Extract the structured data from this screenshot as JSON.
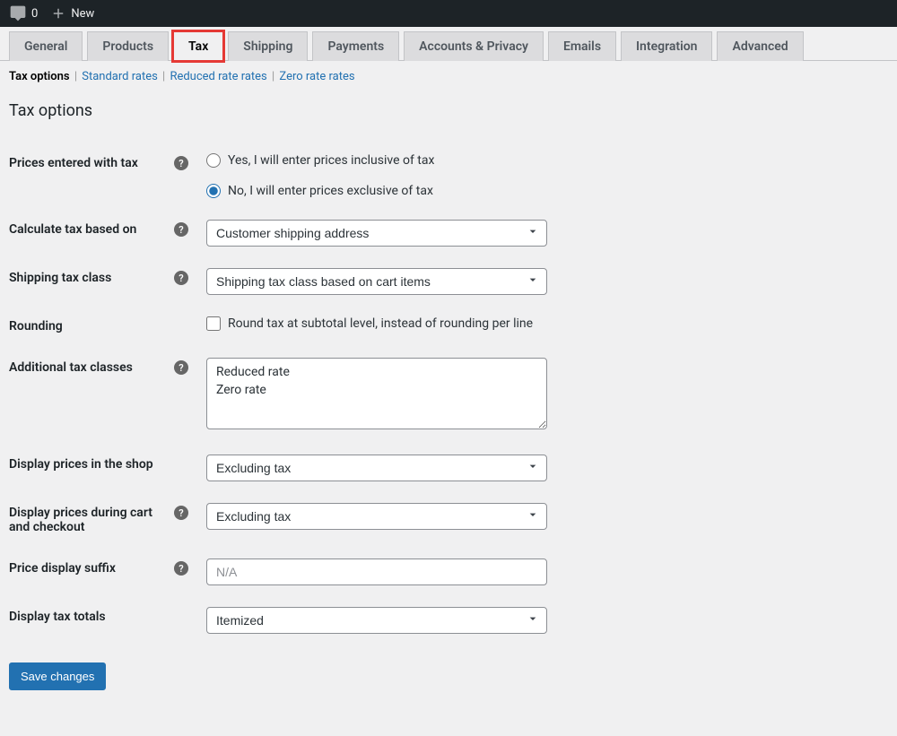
{
  "adminBar": {
    "commentCount": "0",
    "newLabel": "New"
  },
  "tabs": [
    {
      "label": "General"
    },
    {
      "label": "Products"
    },
    {
      "label": "Tax"
    },
    {
      "label": "Shipping"
    },
    {
      "label": "Payments"
    },
    {
      "label": "Accounts & Privacy"
    },
    {
      "label": "Emails"
    },
    {
      "label": "Integration"
    },
    {
      "label": "Advanced"
    }
  ],
  "subNav": {
    "items": [
      {
        "label": "Tax options"
      },
      {
        "label": "Standard rates"
      },
      {
        "label": "Reduced rate rates"
      },
      {
        "label": "Zero rate rates"
      }
    ]
  },
  "sectionTitle": "Tax options",
  "form": {
    "pricesEnteredLabel": "Prices entered with tax",
    "pricesOption1": "Yes, I will enter prices inclusive of tax",
    "pricesOption2": "No, I will enter prices exclusive of tax",
    "calculateTaxLabel": "Calculate tax based on",
    "calculateTaxValue": "Customer shipping address",
    "shippingTaxLabel": "Shipping tax class",
    "shippingTaxValue": "Shipping tax class based on cart items",
    "roundingLabel": "Rounding",
    "roundingCheck": "Round tax at subtotal level, instead of rounding per line",
    "additionalClassesLabel": "Additional tax classes",
    "additionalClassesValue": "Reduced rate\nZero rate",
    "displayShopLabel": "Display prices in the shop",
    "displayShopValue": "Excluding tax",
    "displayCartLabel": "Display prices during cart and checkout",
    "displayCartValue": "Excluding tax",
    "priceSuffixLabel": "Price display suffix",
    "priceSuffixPlaceholder": "N/A",
    "displayTotalsLabel": "Display tax totals",
    "displayTotalsValue": "Itemized",
    "saveButton": "Save changes"
  }
}
